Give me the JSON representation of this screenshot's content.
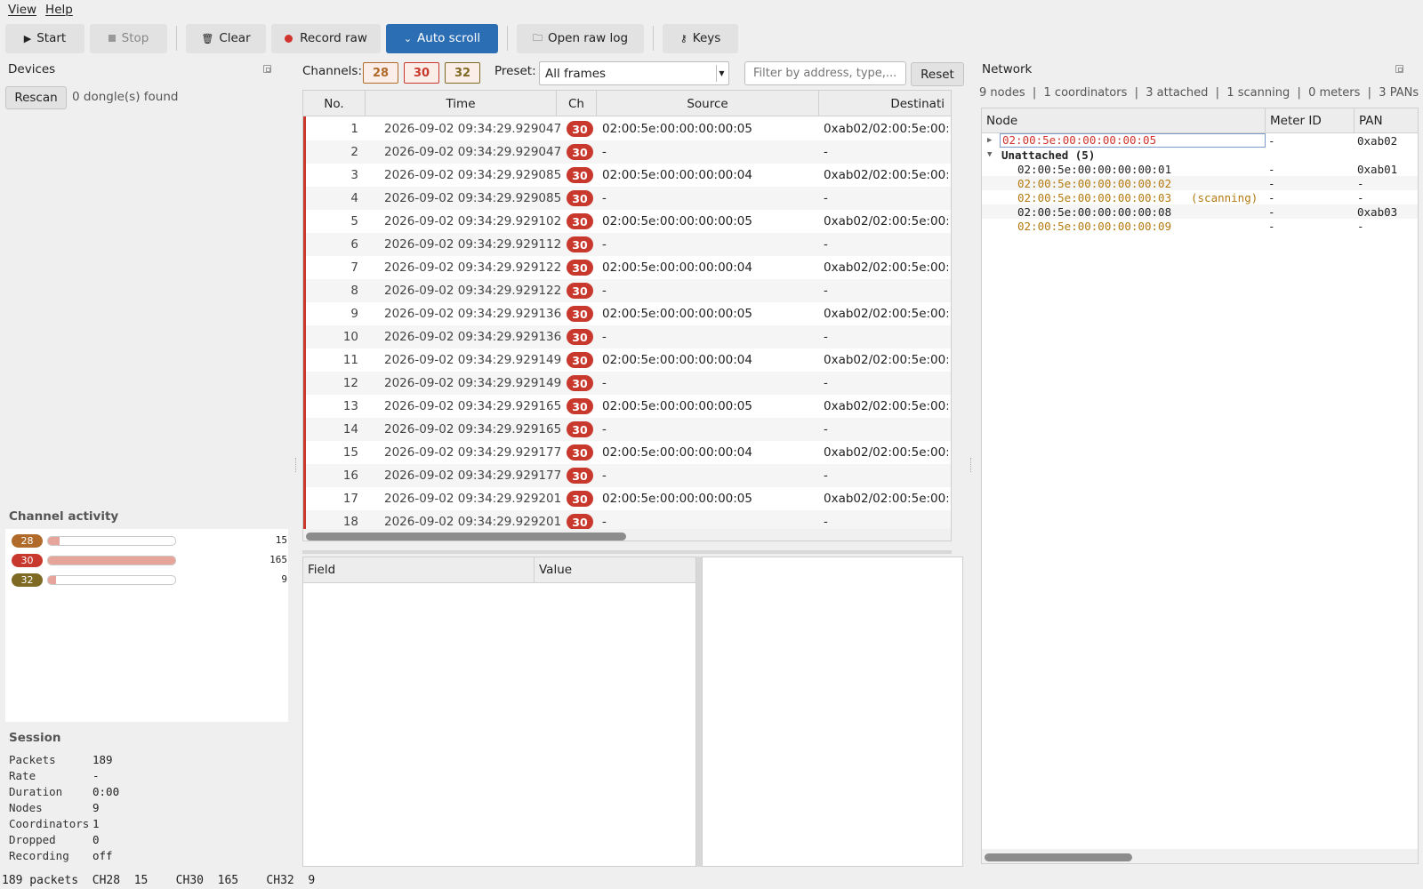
{
  "menu": [
    {
      "label": "View"
    },
    {
      "label": "Help"
    }
  ],
  "toolbar": {
    "start": "Start",
    "stop": "Stop",
    "clear": "Clear",
    "record_raw": "Record raw",
    "auto_scroll": "Auto scroll",
    "open_raw_log": "Open raw log",
    "keys": "Keys",
    "icons": {
      "start": "play-icon",
      "stop": "stop-icon",
      "clear": "trash-icon",
      "record": "record-dot-icon",
      "auto_scroll": "double-chevron-down-icon",
      "open": "folder-icon",
      "keys": "key-icon"
    },
    "primary_color": "#2c6eb4",
    "record_color": "#d0342c"
  },
  "devices": {
    "title": "Devices",
    "rescan": "Rescan",
    "status": "0 dongle(s) found"
  },
  "channel_activity": {
    "title": "Channel activity",
    "max_count": 165,
    "channels": [
      {
        "channel": "28",
        "count": "15",
        "value": 15,
        "color": "#b06a2a"
      },
      {
        "channel": "30",
        "count": "165",
        "value": 165,
        "color": "#c9382c"
      },
      {
        "channel": "32",
        "count": "9",
        "value": 9,
        "color": "#7e6a22"
      }
    ]
  },
  "session": {
    "title": "Session",
    "rows": [
      {
        "key": "Packets",
        "value": "189"
      },
      {
        "key": "Rate",
        "value": "-"
      },
      {
        "key": "Duration",
        "value": "0:00"
      },
      {
        "key": "Nodes",
        "value": "9"
      },
      {
        "key": "Coordinators",
        "value": "1"
      },
      {
        "key": "Dropped",
        "value": "0"
      },
      {
        "key": "Recording",
        "value": "off"
      }
    ]
  },
  "filters": {
    "channels_label": "Channels:",
    "channels": [
      {
        "label": "28",
        "color": "#b06a2a"
      },
      {
        "label": "30",
        "color": "#c9382c"
      },
      {
        "label": "32",
        "color": "#7e6a22"
      }
    ],
    "preset_label": "Preset:",
    "preset_value": "All frames",
    "filter_placeholder": "Filter by address, type,...",
    "reset": "Reset"
  },
  "packets": {
    "columns": [
      "No.",
      "Time",
      "Ch",
      "Source",
      "Destinati"
    ],
    "rows": [
      {
        "no": "1",
        "time": "2026-09-02 09:34:29.929047",
        "ch": "30",
        "src": "02:00:5e:00:00:00:00:05",
        "dst": "0xab02/02:00:5e:00:0"
      },
      {
        "no": "2",
        "time": "2026-09-02 09:34:29.929047",
        "ch": "30",
        "src": "-",
        "dst": "-"
      },
      {
        "no": "3",
        "time": "2026-09-02 09:34:29.929085",
        "ch": "30",
        "src": "02:00:5e:00:00:00:00:04",
        "dst": "0xab02/02:00:5e:00:0"
      },
      {
        "no": "4",
        "time": "2026-09-02 09:34:29.929085",
        "ch": "30",
        "src": "-",
        "dst": "-"
      },
      {
        "no": "5",
        "time": "2026-09-02 09:34:29.929102",
        "ch": "30",
        "src": "02:00:5e:00:00:00:00:05",
        "dst": "0xab02/02:00:5e:00:0"
      },
      {
        "no": "6",
        "time": "2026-09-02 09:34:29.929112",
        "ch": "30",
        "src": "-",
        "dst": "-"
      },
      {
        "no": "7",
        "time": "2026-09-02 09:34:29.929122",
        "ch": "30",
        "src": "02:00:5e:00:00:00:00:04",
        "dst": "0xab02/02:00:5e:00:0"
      },
      {
        "no": "8",
        "time": "2026-09-02 09:34:29.929122",
        "ch": "30",
        "src": "-",
        "dst": "-"
      },
      {
        "no": "9",
        "time": "2026-09-02 09:34:29.929136",
        "ch": "30",
        "src": "02:00:5e:00:00:00:00:05",
        "dst": "0xab02/02:00:5e:00:0"
      },
      {
        "no": "10",
        "time": "2026-09-02 09:34:29.929136",
        "ch": "30",
        "src": "-",
        "dst": "-"
      },
      {
        "no": "11",
        "time": "2026-09-02 09:34:29.929149",
        "ch": "30",
        "src": "02:00:5e:00:00:00:00:04",
        "dst": "0xab02/02:00:5e:00:0"
      },
      {
        "no": "12",
        "time": "2026-09-02 09:34:29.929149",
        "ch": "30",
        "src": "-",
        "dst": "-"
      },
      {
        "no": "13",
        "time": "2026-09-02 09:34:29.929165",
        "ch": "30",
        "src": "02:00:5e:00:00:00:00:05",
        "dst": "0xab02/02:00:5e:00:0"
      },
      {
        "no": "14",
        "time": "2026-09-02 09:34:29.929165",
        "ch": "30",
        "src": "-",
        "dst": "-"
      },
      {
        "no": "15",
        "time": "2026-09-02 09:34:29.929177",
        "ch": "30",
        "src": "02:00:5e:00:00:00:00:04",
        "dst": "0xab02/02:00:5e:00:0"
      },
      {
        "no": "16",
        "time": "2026-09-02 09:34:29.929177",
        "ch": "30",
        "src": "-",
        "dst": "-"
      },
      {
        "no": "17",
        "time": "2026-09-02 09:34:29.929201",
        "ch": "30",
        "src": "02:00:5e:00:00:00:00:05",
        "dst": "0xab02/02:00:5e:00:0"
      },
      {
        "no": "18",
        "time": "2026-09-02 09:34:29.929201",
        "ch": "30",
        "src": "-",
        "dst": "-"
      }
    ]
  },
  "details": {
    "columns": [
      "Field",
      "Value"
    ]
  },
  "network": {
    "title": "Network",
    "summary": "9 nodes  |  1 coordinators  |  3 attached  |  1 scanning  |  0 meters  |  3 PANs",
    "columns": [
      "Node",
      "Meter ID",
      "PAN"
    ],
    "coordinator": {
      "node": "02:00:5e:00:00:00:00:05",
      "meter": "-",
      "pan": "0xab02",
      "color": "#d0342c"
    },
    "group": {
      "label": "Unattached (5)"
    },
    "children": [
      {
        "node": "02:00:5e:00:00:00:00:01",
        "note": "",
        "meter": "-",
        "pan": "0xab01",
        "color": "#222222"
      },
      {
        "node": "02:00:5e:00:00:00:00:02",
        "note": "",
        "meter": "-",
        "pan": "-",
        "color": "#b37a10"
      },
      {
        "node": "02:00:5e:00:00:00:00:03",
        "note": "(scanning)",
        "meter": "-",
        "pan": "-",
        "color": "#b37a10"
      },
      {
        "node": "02:00:5e:00:00:00:00:08",
        "note": "",
        "meter": "-",
        "pan": "0xab03",
        "color": "#222222"
      },
      {
        "node": "02:00:5e:00:00:00:00:09",
        "note": "",
        "meter": "-",
        "pan": "-",
        "color": "#b37a10"
      }
    ]
  },
  "statusbar": "189 packets  CH28  15    CH30  165    CH32  9"
}
